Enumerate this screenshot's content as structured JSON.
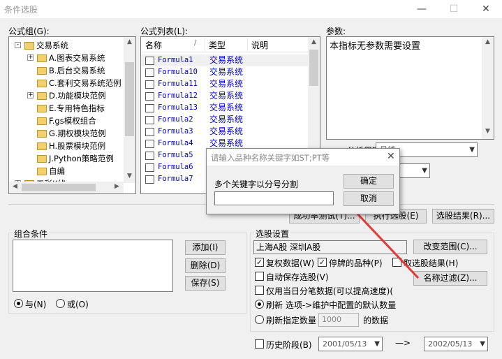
{
  "window": {
    "title": "条件选股"
  },
  "labels": {
    "formula_group": "公式组(G):",
    "formula_list": "公式列表(L):",
    "params": "参数:",
    "cycle": "分析周期(Y):",
    "combo_conditions": "组合条件",
    "select_settings": "选股设置"
  },
  "tree": {
    "items": [
      {
        "label": "交易系统",
        "level": 0,
        "expander": "-"
      },
      {
        "label": "A.图表交易系统",
        "level": 1,
        "expander": "+"
      },
      {
        "label": "B.后台交易系统",
        "level": 1,
        "expander": ""
      },
      {
        "label": "C.套利交易系统范例",
        "level": 1,
        "expander": ""
      },
      {
        "label": "D.功能模块范例",
        "level": 1,
        "expander": "+"
      },
      {
        "label": "E.专用特色指标",
        "level": 1,
        "expander": ""
      },
      {
        "label": "F.gs模权组合",
        "level": 1,
        "expander": ""
      },
      {
        "label": "G.期权模块范例",
        "level": 1,
        "expander": ""
      },
      {
        "label": "H.股票模块范例",
        "level": 1,
        "expander": ""
      },
      {
        "label": "J.Python策略范例",
        "level": 1,
        "expander": ""
      },
      {
        "label": "自编",
        "level": 1,
        "expander": ""
      },
      {
        "label": "五彩K线",
        "level": 0,
        "expander": "+"
      }
    ]
  },
  "formula_list": {
    "columns": [
      "名称",
      "类型",
      "说明"
    ],
    "rows": [
      {
        "name": "Formula1",
        "type": "交易系统"
      },
      {
        "name": "Formula10",
        "type": "交易系统"
      },
      {
        "name": "Formula11",
        "type": "交易系统"
      },
      {
        "name": "Formula12",
        "type": "交易系统"
      },
      {
        "name": "Formula13",
        "type": "交易系统"
      },
      {
        "name": "Formula2",
        "type": "交易系统"
      },
      {
        "name": "Formula3",
        "type": "交易系统"
      },
      {
        "name": "Formula4",
        "type": "交易系统"
      },
      {
        "name": "Formula5",
        "type": "交易系统"
      },
      {
        "name": "Formula6",
        "type": "交易系统"
      },
      {
        "name": "Formula7",
        "type": "交易系统"
      }
    ]
  },
  "params_text": "本指标无参数需要设置",
  "cycle_value": "日线",
  "buttons": {
    "success_test": "成功率测试(T)...",
    "run_select": "执行选股(E)",
    "select_result": "选股结果(R)...",
    "add": "添加(I)",
    "delete": "删除(D)",
    "save": "保存(S)",
    "change_range": "改变范围(C)...",
    "name_filter": "名称过滤(Z)...",
    "ok": "确定",
    "cancel": "取消"
  },
  "logic": {
    "and": "与(N)",
    "or": "或(O)"
  },
  "settings": {
    "markets": "上海A股  深圳A股",
    "restored_data": "复权数据(W)",
    "suspended": "停牌的品种(P)",
    "take_result": "取选股结果(H)",
    "auto_save": "自动保存选股(V)",
    "intraday_only": "仅用当日分笔数据(可以提高速度)(",
    "refresh_select": "刷新 选项->维护中配置的默认数量",
    "refresh_count": "刷新指定数量",
    "count_value": "1000",
    "count_suffix": "的数据",
    "history": "历史阶段(B)",
    "date_from": "2001/05/13",
    "arrow": "—>",
    "date_to": "2002/05/13"
  },
  "dialog": {
    "title": "请输入品种名称关键字如ST;PT等",
    "prompt": "多个关键字以分号分割",
    "input_value": ""
  },
  "colors": {
    "annotation_arrow": "#e53935",
    "list_text": "#0000c0"
  }
}
